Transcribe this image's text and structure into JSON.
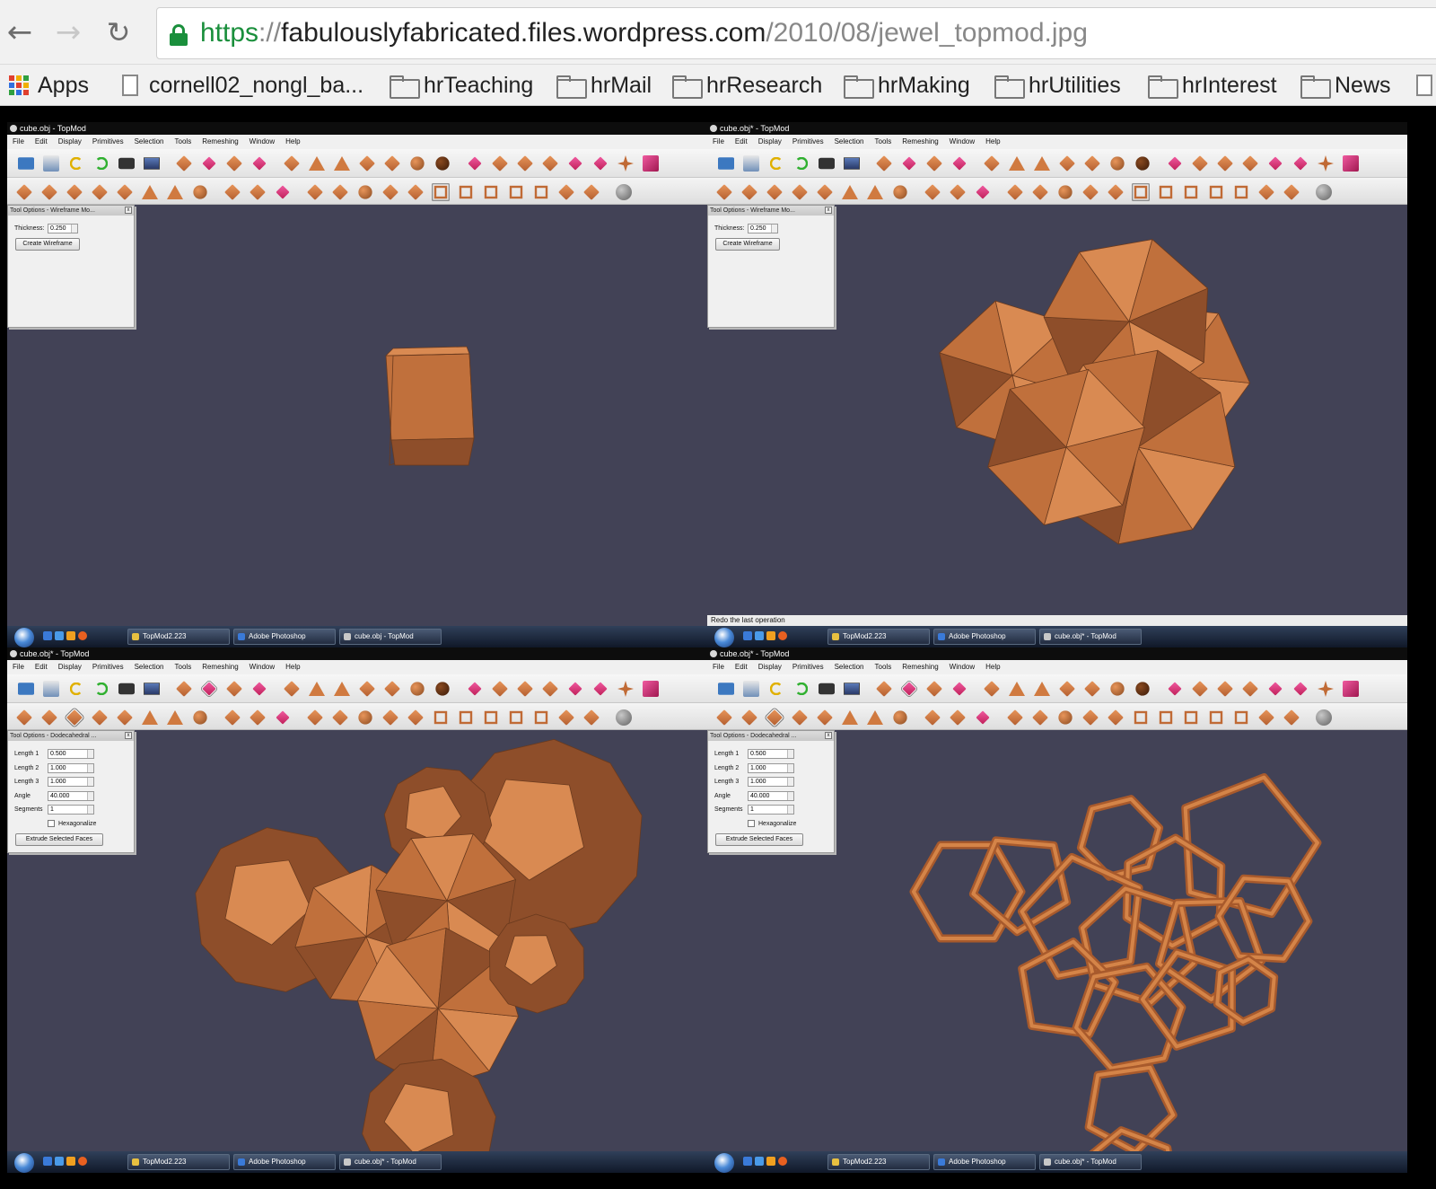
{
  "browser": {
    "url": {
      "scheme": "https",
      "separator": "://",
      "host": "fabulouslyfabricated.files.wordpress.com",
      "path": "/2010/08/jewel_topmod.jpg"
    },
    "bookmarks": [
      {
        "label": "Apps",
        "icon": "apps-grid-icon"
      },
      {
        "label": "cornell02_nongl_ba...",
        "icon": "page-icon"
      },
      {
        "label": "hrTeaching",
        "icon": "folder-icon"
      },
      {
        "label": "hrMail",
        "icon": "folder-icon"
      },
      {
        "label": "hrResearch",
        "icon": "folder-icon"
      },
      {
        "label": "hrMaking",
        "icon": "folder-icon"
      },
      {
        "label": "hrUtilities",
        "icon": "folder-icon"
      },
      {
        "label": "hrInterest",
        "icon": "folder-icon"
      },
      {
        "label": "News",
        "icon": "folder-icon"
      }
    ]
  },
  "topmod": {
    "menu": [
      "File",
      "Edit",
      "Display",
      "Primitives",
      "Selection",
      "Tools",
      "Remeshing",
      "Window",
      "Help"
    ],
    "panels": [
      {
        "title": "cube.obj - TopMod",
        "dock_title": "Tool Options - Wireframe Mo...",
        "tool": "wireframe",
        "thickness_label": "Thickness:",
        "thickness": "0.250",
        "button": "Create Wireframe",
        "status": "",
        "model": "cube",
        "taskbar": [
          "TopMod2.223",
          "Adobe Photoshop",
          "cube.obj - TopMod"
        ]
      },
      {
        "title": "cube.obj* - TopMod",
        "dock_title": "Tool Options - Wireframe Mo...",
        "tool": "wireframe",
        "thickness_label": "Thickness:",
        "thickness": "0.250",
        "button": "Create Wireframe",
        "status": "Redo the last operation",
        "model": "polyhedral-cluster",
        "taskbar": [
          "TopMod2.223",
          "Adobe Photoshop",
          "cube.obj* - TopMod"
        ]
      },
      {
        "title": "cube.obj* - TopMod",
        "dock_title": "Tool Options - Dodecahedral ...",
        "tool": "dodecahedral",
        "fields": [
          {
            "label": "Length 1",
            "value": "0.500"
          },
          {
            "label": "Length 2",
            "value": "1.000"
          },
          {
            "label": "Length 3",
            "value": "1.000"
          },
          {
            "label": "Angle",
            "value": "40.000"
          },
          {
            "label": "Segments",
            "value": "1"
          }
        ],
        "checkbox_label": "Hexagonalize",
        "button": "Extrude Selected Faces",
        "status": "",
        "model": "dodecahedral-extrusion",
        "taskbar": [
          "TopMod2.223",
          "Adobe Photoshop",
          "cube.obj* - TopMod"
        ]
      },
      {
        "title": "cube.obj* - TopMod",
        "dock_title": "Tool Options - Dodecahedral ...",
        "tool": "dodecahedral",
        "fields": [
          {
            "label": "Length 1",
            "value": "0.500"
          },
          {
            "label": "Length 2",
            "value": "1.000"
          },
          {
            "label": "Length 3",
            "value": "1.000"
          },
          {
            "label": "Angle",
            "value": "40.000"
          },
          {
            "label": "Segments",
            "value": "1"
          }
        ],
        "checkbox_label": "Hexagonalize",
        "button": "Extrude Selected Faces",
        "status": "",
        "model": "wireframe-jewel",
        "taskbar": [
          "TopMod2.223",
          "Adobe Photoshop",
          "cube.obj* - TopMod"
        ]
      }
    ]
  },
  "colors": {
    "viewport_bg": "#424256",
    "model_light": "#d98a52",
    "model_mid": "#c0703c",
    "model_dark": "#8e4e2a",
    "url_green": "#1a8f3c"
  }
}
